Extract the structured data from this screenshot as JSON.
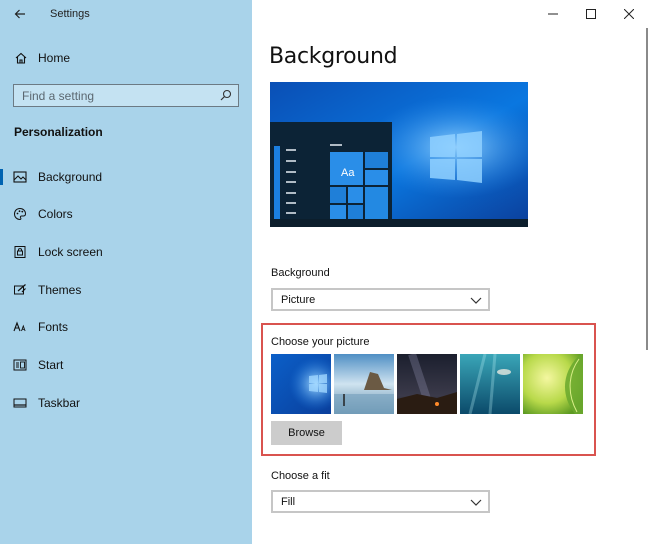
{
  "window": {
    "title": "Settings",
    "colors": {
      "sidebar": "#a9d3ea",
      "accent": "#0063b1",
      "highlight": "#d9534f"
    }
  },
  "sidebar": {
    "home_label": "Home",
    "search_placeholder": "Find a setting",
    "section_title": "Personalization",
    "items": [
      {
        "label": "Background",
        "icon": "picture-icon",
        "active": true
      },
      {
        "label": "Colors",
        "icon": "palette-icon",
        "active": false
      },
      {
        "label": "Lock screen",
        "icon": "lock-screen-icon",
        "active": false
      },
      {
        "label": "Themes",
        "icon": "themes-icon",
        "active": false
      },
      {
        "label": "Fonts",
        "icon": "fonts-icon",
        "active": false
      },
      {
        "label": "Start",
        "icon": "start-icon",
        "active": false
      },
      {
        "label": "Taskbar",
        "icon": "taskbar-icon",
        "active": false
      }
    ]
  },
  "main": {
    "title": "Background",
    "preview_tile_text": "Aa",
    "background_label": "Background",
    "background_value": "Picture",
    "choose_picture_label": "Choose your picture",
    "browse_label": "Browse",
    "fit_label": "Choose a fit",
    "fit_value": "Fill"
  }
}
